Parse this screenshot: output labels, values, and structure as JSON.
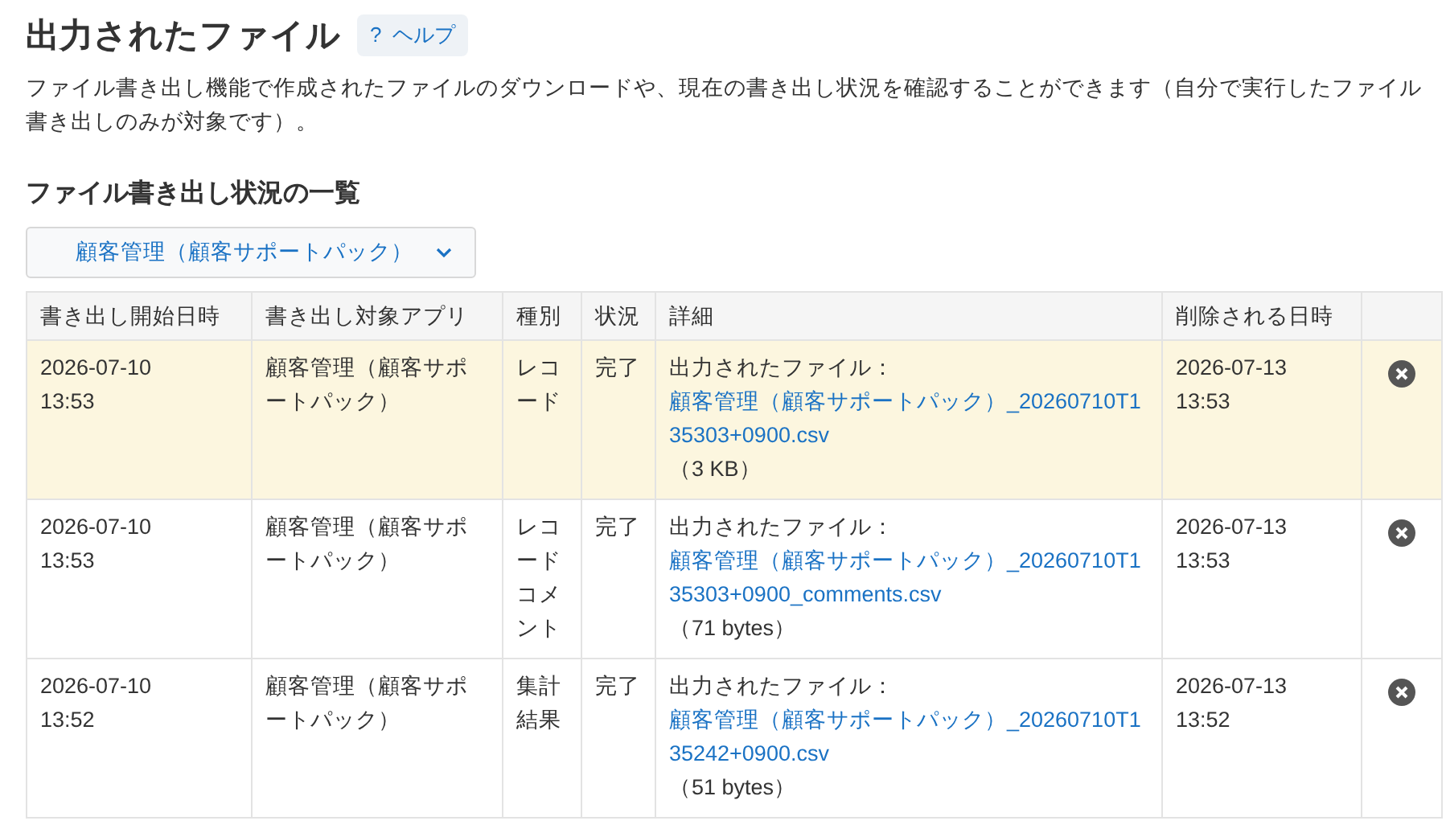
{
  "page": {
    "title": "出力されたファイル",
    "help_icon": "?",
    "help_label": "ヘルプ",
    "description": "ファイル書き出し機能で作成されたファイルのダウンロードや、現在の書き出し状況を確認することができます（自分で実行したファイル書き出しのみが対象です）。"
  },
  "section": {
    "title": "ファイル書き出し状況の一覧",
    "app_select": {
      "value": "顧客管理（顧客サポートパック）"
    }
  },
  "table": {
    "columns": [
      "書き出し開始日時",
      "書き出し対象アプリ",
      "種別",
      "状況",
      "詳細",
      "削除される日時"
    ],
    "rows": [
      {
        "selected": true,
        "start": "2026-07-10 13:53",
        "app": "顧客管理（顧客サポートパック）",
        "type": "レコード",
        "status": "完了",
        "detail_prefix": "出力されたファイル：",
        "file_name": "顧客管理（顧客サポートパック）_20260710T135303+0900.csv",
        "size": "（3 KB）",
        "delete_at": "2026-07-13 13:53"
      },
      {
        "selected": false,
        "start": "2026-07-10 13:53",
        "app": "顧客管理（顧客サポートパック）",
        "type": "レコードコメント",
        "status": "完了",
        "detail_prefix": "出力されたファイル：",
        "file_name": "顧客管理（顧客サポートパック）_20260710T135303+0900_comments.csv",
        "size": "（71 bytes）",
        "delete_at": "2026-07-13 13:53"
      },
      {
        "selected": false,
        "start": "2026-07-10 13:52",
        "app": "顧客管理（顧客サポートパック）",
        "type": "集計結果",
        "status": "完了",
        "detail_prefix": "出力されたファイル：",
        "file_name": "顧客管理（顧客サポートパック）_20260710T135242+0900.csv",
        "size": "（51 bytes）",
        "delete_at": "2026-07-13 13:52"
      }
    ]
  }
}
